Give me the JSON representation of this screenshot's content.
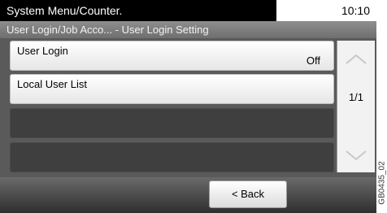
{
  "header": {
    "title": "System Menu/Counter.",
    "time": "10:10"
  },
  "breadcrumb": "User Login/Job Acco... - User Login Setting",
  "list": {
    "items": [
      {
        "label": "User Login",
        "value": "Off"
      },
      {
        "label": "Local User List",
        "value": ""
      }
    ]
  },
  "pager": {
    "page": "1/1"
  },
  "icons": {
    "scroll_up": "chevron-up-icon",
    "scroll_down": "chevron-down-icon"
  },
  "footer": {
    "back_label": "< Back"
  },
  "figure_code": "GB0435_02"
}
